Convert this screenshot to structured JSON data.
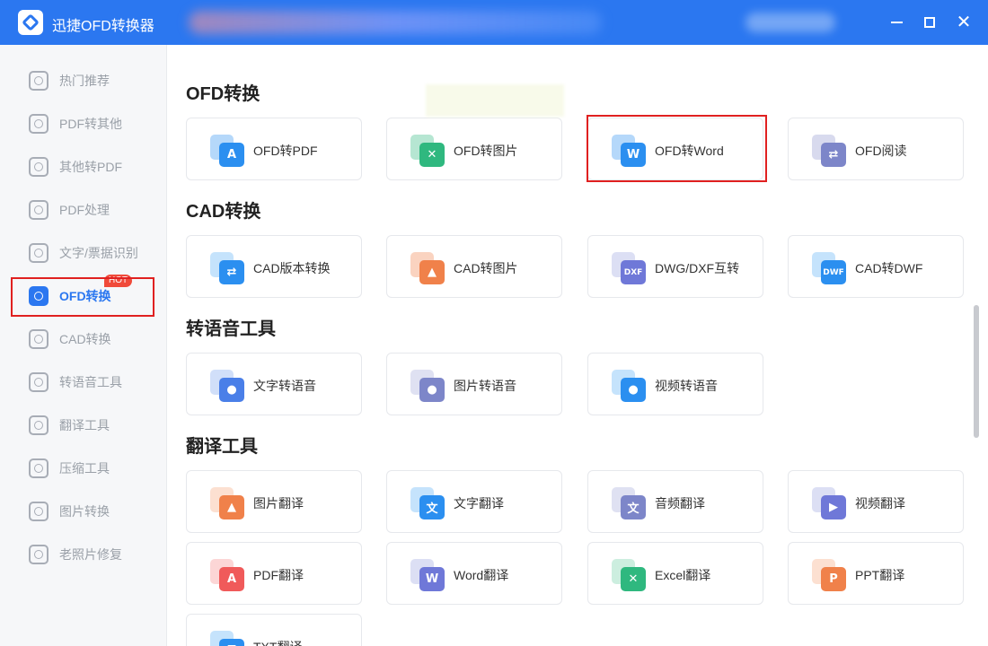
{
  "app": {
    "title": "迅捷OFD转换器"
  },
  "sidebar": {
    "items": [
      {
        "label": "热门推荐",
        "icon": "hot-recommend-icon"
      },
      {
        "label": "PDF转其他",
        "icon": "pdf-convert-icon"
      },
      {
        "label": "其他转PDF",
        "icon": "to-pdf-icon"
      },
      {
        "label": "PDF处理",
        "icon": "pdf-process-icon"
      },
      {
        "label": "文字/票据识别",
        "icon": "ocr-icon"
      },
      {
        "label": "OFD转换",
        "icon": "ofd-convert-icon",
        "active": true,
        "badge": "HOT"
      },
      {
        "label": "CAD转换",
        "icon": "cad-convert-icon"
      },
      {
        "label": "转语音工具",
        "icon": "voice-tool-icon"
      },
      {
        "label": "翻译工具",
        "icon": "translate-tool-icon"
      },
      {
        "label": "压缩工具",
        "icon": "compress-tool-icon"
      },
      {
        "label": "图片转换",
        "icon": "image-convert-icon"
      },
      {
        "label": "老照片修复",
        "icon": "photo-repair-icon"
      }
    ]
  },
  "sections": [
    {
      "title": "OFD转换",
      "cards": [
        {
          "label": "OFD转PDF",
          "glyph": "A",
          "color": "#2b8ff0",
          "back": "#2b8ff0"
        },
        {
          "label": "OFD转图片",
          "glyph": "✕",
          "color": "#2fb87f",
          "back": "#2fb87f"
        },
        {
          "label": "OFD转Word",
          "glyph": "W",
          "color": "#2b8ff0",
          "back": "#2b8ff0"
        },
        {
          "label": "OFD阅读",
          "glyph": "⇄",
          "color": "#7d86c9",
          "back": "#8e96cf"
        }
      ]
    },
    {
      "title": "CAD转换",
      "cards": [
        {
          "label": "CAD版本转换",
          "glyph": "⇄",
          "color": "#2b8ff0",
          "back": "#5aaef5"
        },
        {
          "label": "CAD转图片",
          "glyph": "▲",
          "color": "#f0814a",
          "back": "#f0814a"
        },
        {
          "label": "DWG/DXF互转",
          "glyph": "DXF",
          "color": "#6f78d8",
          "back": "#9aa2e0"
        },
        {
          "label": "CAD转DWF",
          "glyph": "DWF",
          "color": "#2b8ff0",
          "back": "#5aaef5"
        }
      ]
    },
    {
      "title": "转语音工具",
      "cards": [
        {
          "label": "文字转语音",
          "glyph": "●",
          "color": "#4a7fe8",
          "back": "#7aa3ee"
        },
        {
          "label": "图片转语音",
          "glyph": "●",
          "color": "#7d86c9",
          "back": "#a3aadb"
        },
        {
          "label": "视频转语音",
          "glyph": "●",
          "color": "#2b8ff0",
          "back": "#5aaef5"
        }
      ]
    },
    {
      "title": "翻译工具",
      "cards": [
        {
          "label": "图片翻译",
          "glyph": "▲",
          "color": "#f0814a",
          "back": "#f5a57a"
        },
        {
          "label": "文字翻译",
          "glyph": "文",
          "color": "#2b8ff0",
          "back": "#5aaef5"
        },
        {
          "label": "音频翻译",
          "glyph": "文",
          "color": "#7d86c9",
          "back": "#a3aadb"
        },
        {
          "label": "视频翻译",
          "glyph": "▶",
          "color": "#6f78d8",
          "back": "#9aa2e0"
        },
        {
          "label": "PDF翻译",
          "glyph": "A",
          "color": "#f05a5a",
          "back": "#f58a8a"
        },
        {
          "label": "Word翻译",
          "glyph": "W",
          "color": "#6f78d8",
          "back": "#9aa2e0"
        },
        {
          "label": "Excel翻译",
          "glyph": "✕",
          "color": "#2fb87f",
          "back": "#6ccfa2"
        },
        {
          "label": "PPT翻译",
          "glyph": "P",
          "color": "#f0814a",
          "back": "#f5a57a"
        },
        {
          "label": "TXT翻译",
          "glyph": "T",
          "color": "#2b8ff0",
          "back": "#5aaef5"
        }
      ]
    }
  ]
}
